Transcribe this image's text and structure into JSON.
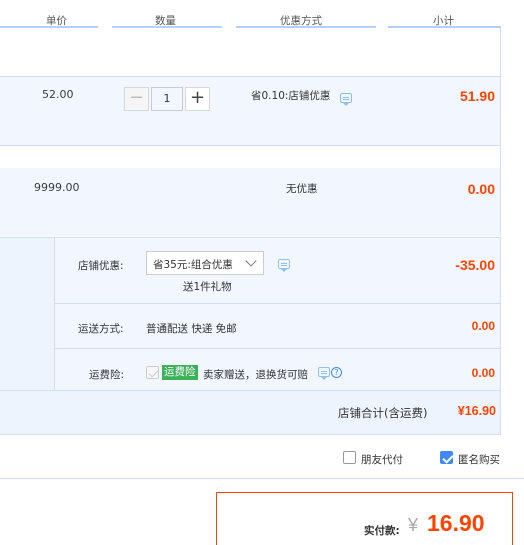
{
  "header": {
    "col_price": "单价",
    "col_qty": "数量",
    "col_discount": "优惠方式",
    "col_subtotal": "小计"
  },
  "items": [
    {
      "price": "52.00",
      "quantity": "1",
      "discount": "省0.10:店铺优惠",
      "subtotal": "51.90"
    },
    {
      "price": "9999.00",
      "discount": "无优惠",
      "subtotal": "0.00"
    }
  ],
  "shop": {
    "promo_label": "店铺优惠:",
    "promo_selected": "省35元:组合优惠",
    "promo_gift": "送1件礼物",
    "promo_amount": "-35.00",
    "shipping_label": "运送方式:",
    "shipping_value": "普通配送 快递 免邮",
    "shipping_amount": "0.00",
    "insurance_label": "运费险:",
    "insurance_badge": "运费险",
    "insurance_text": "卖家赠送，退换货可赔",
    "insurance_amount": "0.00",
    "shop_total_label": "店铺合计(含运费)",
    "shop_total_value": "¥16.90"
  },
  "options": {
    "friend_pay": "朋友代付",
    "friend_pay_checked": false,
    "anonymous": "匿名购买",
    "anonymous_checked": true
  },
  "payment": {
    "label": "实付款:",
    "currency": "¥",
    "amount": "16.90"
  },
  "colors": {
    "accent_red": "#ff4400",
    "border_blue": "#b2d1ff",
    "band_bg": "#f2f7ff",
    "check_blue": "#3d8af7",
    "badge_green": "#3db05a"
  },
  "icons": [
    "chat-icon",
    "help-icon",
    "chevron-down-icon",
    "minus-icon",
    "plus-icon",
    "checkbox-icon"
  ]
}
